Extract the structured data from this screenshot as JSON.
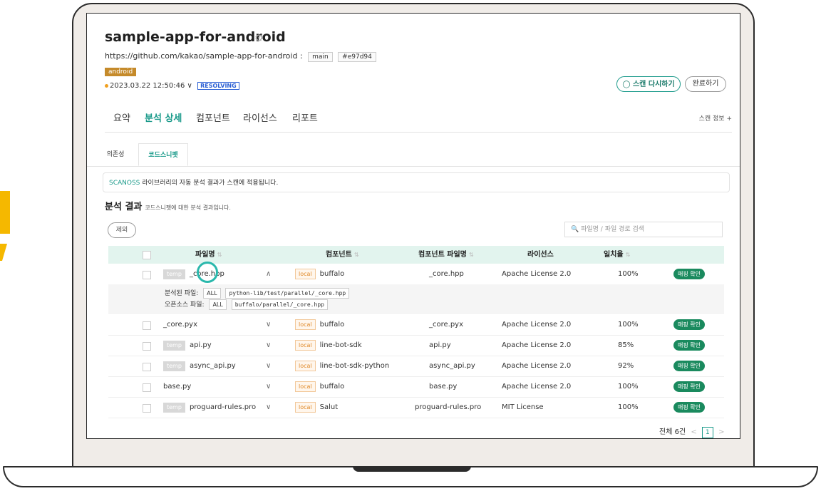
{
  "app": {
    "title": "sample-app-for-android",
    "url": "https://github.com/kakao/sample-app-for-android",
    "url_sep": ":",
    "branch": "main",
    "commit": "#e97d94",
    "platform_tag": "android",
    "scan_time": "2023.03.22 12:50:46",
    "scan_time_chevron": "∨",
    "status": "RESOLVING"
  },
  "actions": {
    "rescan_label": "◯ 스캔 다시하기",
    "done_label": "완료하기"
  },
  "tabs": [
    {
      "label": "요약"
    },
    {
      "label": "분석 상세"
    },
    {
      "label": "컴포넌트"
    },
    {
      "label": "라이선스"
    },
    {
      "label": "리포트"
    }
  ],
  "scan_info_link": "스캔 정보 +",
  "subtabs": [
    {
      "label": "의존성"
    },
    {
      "label": "코드스니펫"
    }
  ],
  "notice": {
    "highlight": "SCANOSS",
    "text": " 라이브러리의 자동 분석 결과가 스캔에 적용됩니다."
  },
  "results": {
    "title": "분석 결과",
    "description": "코드스니펫에 대한 분석 결과입니다.",
    "exclude_label": "제외",
    "search_placeholder": "🔍 파일명 / 파일 경로 검색"
  },
  "table": {
    "columns": [
      "파일명",
      "컴포넌트",
      "컴포넌트 파일명",
      "라이선스",
      "일치율"
    ],
    "sort_glyph": "⇅",
    "rows": [
      {
        "tag": "temp",
        "file": "_core.hpp",
        "chevron": "∧",
        "scope": "local",
        "component": "buffalo",
        "component_file": "_core.hpp",
        "license": "Apache License 2.0",
        "match": "100%",
        "action": "매핑 확인"
      },
      {
        "tag": "",
        "file": "_core.pyx",
        "chevron": "∨",
        "scope": "local",
        "component": "buffalo",
        "component_file": "_core.pyx",
        "license": "Apache License 2.0",
        "match": "100%",
        "action": "매핑 확인"
      },
      {
        "tag": "temp",
        "file": "api.py",
        "chevron": "∨",
        "scope": "local",
        "component": "line-bot-sdk",
        "component_file": "api.py",
        "license": "Apache License 2.0",
        "match": "85%",
        "action": "매핑 확인"
      },
      {
        "tag": "temp",
        "file": "async_api.py",
        "chevron": "∨",
        "scope": "local",
        "component": "line-bot-sdk-python",
        "component_file": "async_api.py",
        "license": "Apache License 2.0",
        "match": "92%",
        "action": "매핑 확인"
      },
      {
        "tag": "",
        "file": "base.py",
        "chevron": "∨",
        "scope": "local",
        "component": "buffalo",
        "component_file": "base.py",
        "license": "Apache License 2.0",
        "match": "100%",
        "action": "매핑 확인"
      },
      {
        "tag": "temp",
        "file": "proguard-rules.pro",
        "chevron": "∨",
        "scope": "local",
        "component": "Salut",
        "component_file": "proguard-rules.pro",
        "license": "MIT License",
        "match": "100%",
        "action": "매핑 확인"
      }
    ],
    "detail": {
      "analyzed_label": "분석된 파일:",
      "analyzed_scope": "ALL",
      "analyzed_path": "python-lib/test/parallel/_core.hpp",
      "oss_label": "오픈소스 파일:",
      "oss_scope": "ALL",
      "oss_path": "buffalo/parallel/_core.hpp"
    }
  },
  "pagination": {
    "total": "전체 6건",
    "prev": "<",
    "current": "1",
    "next": ">"
  },
  "colors": {
    "accent": "#1a9a8a",
    "badge": "#1a8a5e",
    "header_bg": "#e2f4ee",
    "platform_tag": "#c58a2a",
    "status": "#2b5fd4"
  }
}
